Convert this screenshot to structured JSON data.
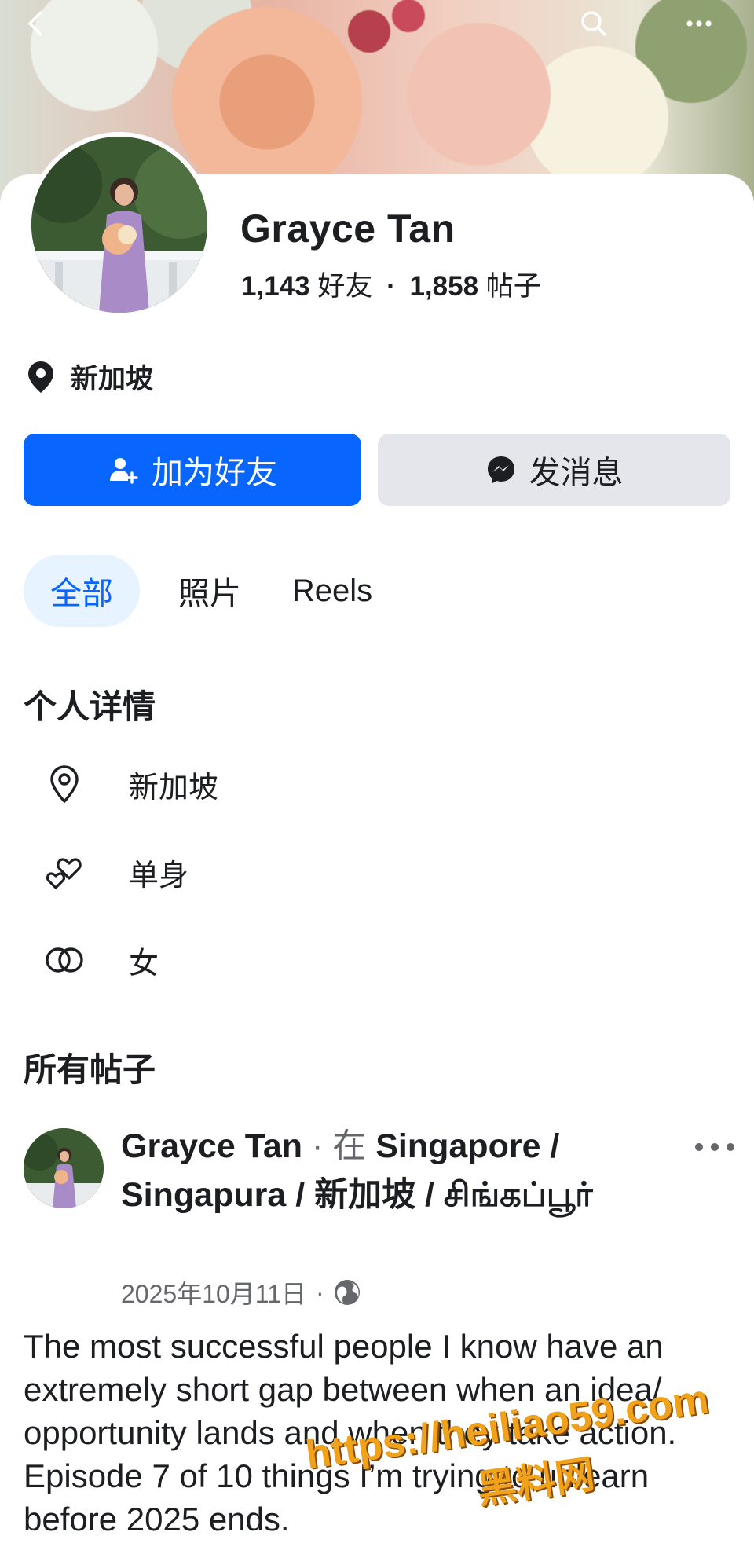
{
  "topbar": {
    "back_icon": "chevron-left-icon",
    "search_icon": "search-icon",
    "more_icon": "more-horizontal-icon"
  },
  "profile": {
    "name": "Grayce Tan",
    "friends_count": "1,143",
    "friends_label": "好友",
    "separator": "·",
    "posts_count": "1,858",
    "posts_label": "帖子",
    "location": "新加坡"
  },
  "actions": {
    "add_friend_label": "加为好友",
    "message_label": "发消息"
  },
  "tabs": [
    {
      "label": "全部",
      "active": true
    },
    {
      "label": "照片",
      "active": false
    },
    {
      "label": "Reels",
      "active": false
    }
  ],
  "details": {
    "title": "个人详情",
    "items": [
      {
        "icon": "location-pin-icon",
        "text": "新加坡"
      },
      {
        "icon": "hearts-icon",
        "text": "单身"
      },
      {
        "icon": "gender-rings-icon",
        "text": "女"
      }
    ]
  },
  "posts_section": {
    "title": "所有帖子"
  },
  "post": {
    "author": "Grayce Tan",
    "connector": "· 在",
    "place": "Singapore / Singapura / 新加坡 / சிங்கப்பூர்",
    "date": "2025年10月11日",
    "date_separator": "·",
    "privacy_icon": "globe-icon",
    "body": "The most successful people I know have an extremely short gap between when an idea/ opportunity lands and when they take action. Episode 7 of 10 things I’m trying to unlearn before 2025 ends."
  },
  "watermark": {
    "url": "https://heiliao59.com",
    "text": "黑料网"
  },
  "colors": {
    "primary": "#0866ff",
    "secondary_button": "#e4e6eb",
    "active_tab_bg": "#e7f3ff",
    "muted_text": "#65676b",
    "watermark": "#f0a21a"
  }
}
